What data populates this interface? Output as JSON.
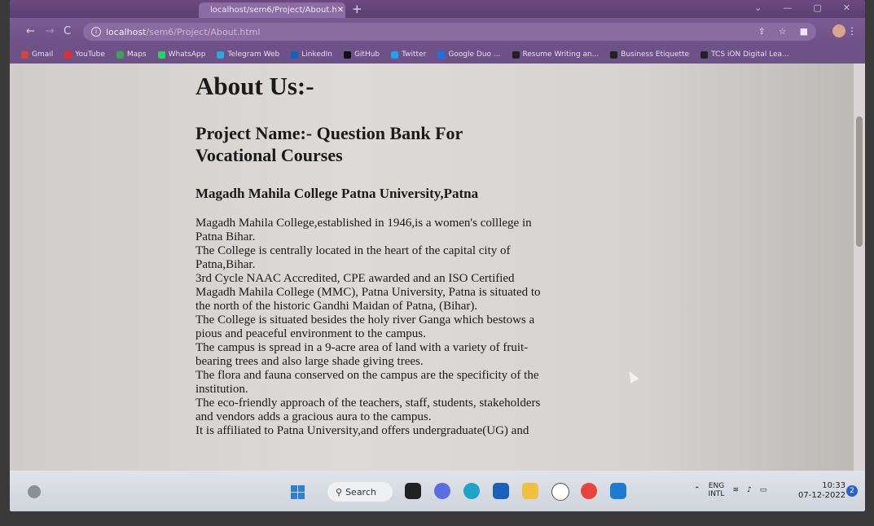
{
  "browser": {
    "active_tab_title": "localhost/sem6/Project/About.h",
    "url_host": "localhost",
    "url_path": "/sem6/Project/About.html"
  },
  "bookmarks": [
    {
      "label": "Gmail",
      "color": "#d44638"
    },
    {
      "label": "YouTube",
      "color": "#e52d27"
    },
    {
      "label": "Maps",
      "color": "#34a853"
    },
    {
      "label": "WhatsApp",
      "color": "#25d366"
    },
    {
      "label": "Telegram Web",
      "color": "#2ca5e0"
    },
    {
      "label": "LinkedIn",
      "color": "#0a66c2"
    },
    {
      "label": "GitHub",
      "color": "#111111"
    },
    {
      "label": "Twitter",
      "color": "#1da1f2"
    },
    {
      "label": "Google Duo ...",
      "color": "#1a73e8"
    },
    {
      "label": "Resume Writing an...",
      "color": "#222222"
    },
    {
      "label": "Business Etiquette",
      "color": "#222222"
    },
    {
      "label": "TCS iON Digital Lea...",
      "color": "#222222"
    }
  ],
  "page": {
    "title": "About Us:-",
    "project_name": "Project Name:- Question Bank For Vocational Courses",
    "college_name": "Magadh Mahila College Patna University,Patna",
    "description_lines": [
      "Magadh Mahila College,established in 1946,is a women's colllege in",
      "Patna Bihar.",
      "The College is centrally located in the heart of the capital city of",
      "Patna,Bihar.",
      "3rd Cycle NAAC Accredited, CPE awarded and an ISO Certified",
      "Magadh Mahila College (MMC), Patna University, Patna is situated to",
      "the north of the historic Gandhi Maidan of Patna, (Bihar).",
      "The College is situated besides the holy river Ganga which bestows a",
      "pious and peaceful environment to the campus.",
      "The campus is spread in a 9-acre area of land with a variety of fruit-",
      "bearing trees and also large shade giving trees.",
      "The flora and fauna conserved on the campus are the specificity of the",
      "institution.",
      "The eco-friendly approach of the teachers, staff, students, stakeholders",
      "and vendors adds a gracious aura to the campus.",
      "It is affiliated to Patna University,and offers undergraduate(UG) and"
    ]
  },
  "taskbar": {
    "search_label": "Search",
    "lang_top": "ENG",
    "lang_bottom": "INTL",
    "time": "10:33",
    "date": "07-12-2022",
    "notification_count": "2"
  }
}
